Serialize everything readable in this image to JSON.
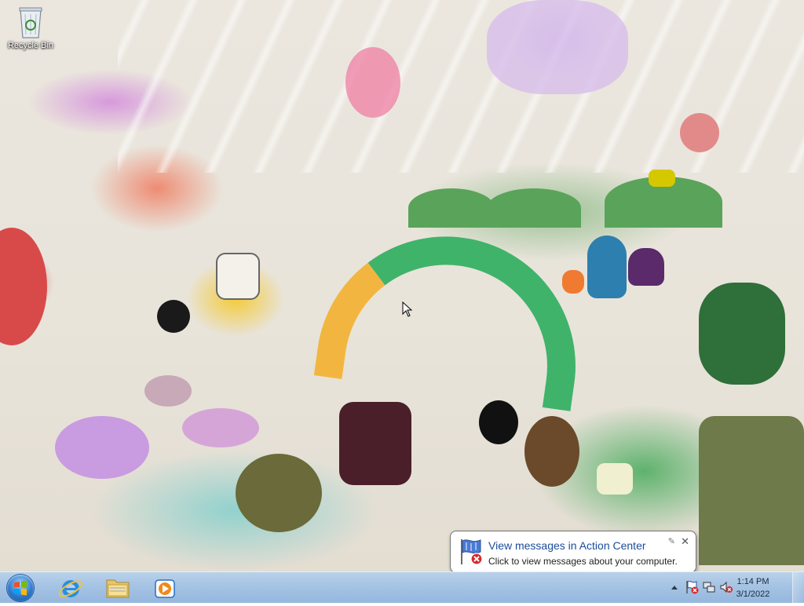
{
  "desktop": {
    "icons": [
      {
        "label": "Recycle Bin",
        "icon": "recycle-bin-icon"
      }
    ]
  },
  "taskbar": {
    "start_icon": "windows-start-icon",
    "pinned": [
      {
        "name": "Internet Explorer",
        "icon": "internet-explorer-icon"
      },
      {
        "name": "Windows Explorer",
        "icon": "folder-icon"
      },
      {
        "name": "Windows Media Player",
        "icon": "media-player-icon"
      }
    ],
    "tray": {
      "show_hidden_icon": "chevron-up-icon",
      "icons": [
        "action-center-flag-icon",
        "network-icon",
        "volume-muted-icon"
      ],
      "time": "1:14 PM",
      "date": "3/1/2022"
    }
  },
  "balloon": {
    "title": "View messages in Action Center",
    "text": "Click to view messages about your computer.",
    "close_glyph": "✕",
    "pin_glyph": "✎"
  },
  "colors": {
    "taskbar": "#a5c3e4",
    "balloon_title": "#1a4d9c",
    "accent": "#2f7bd0"
  }
}
